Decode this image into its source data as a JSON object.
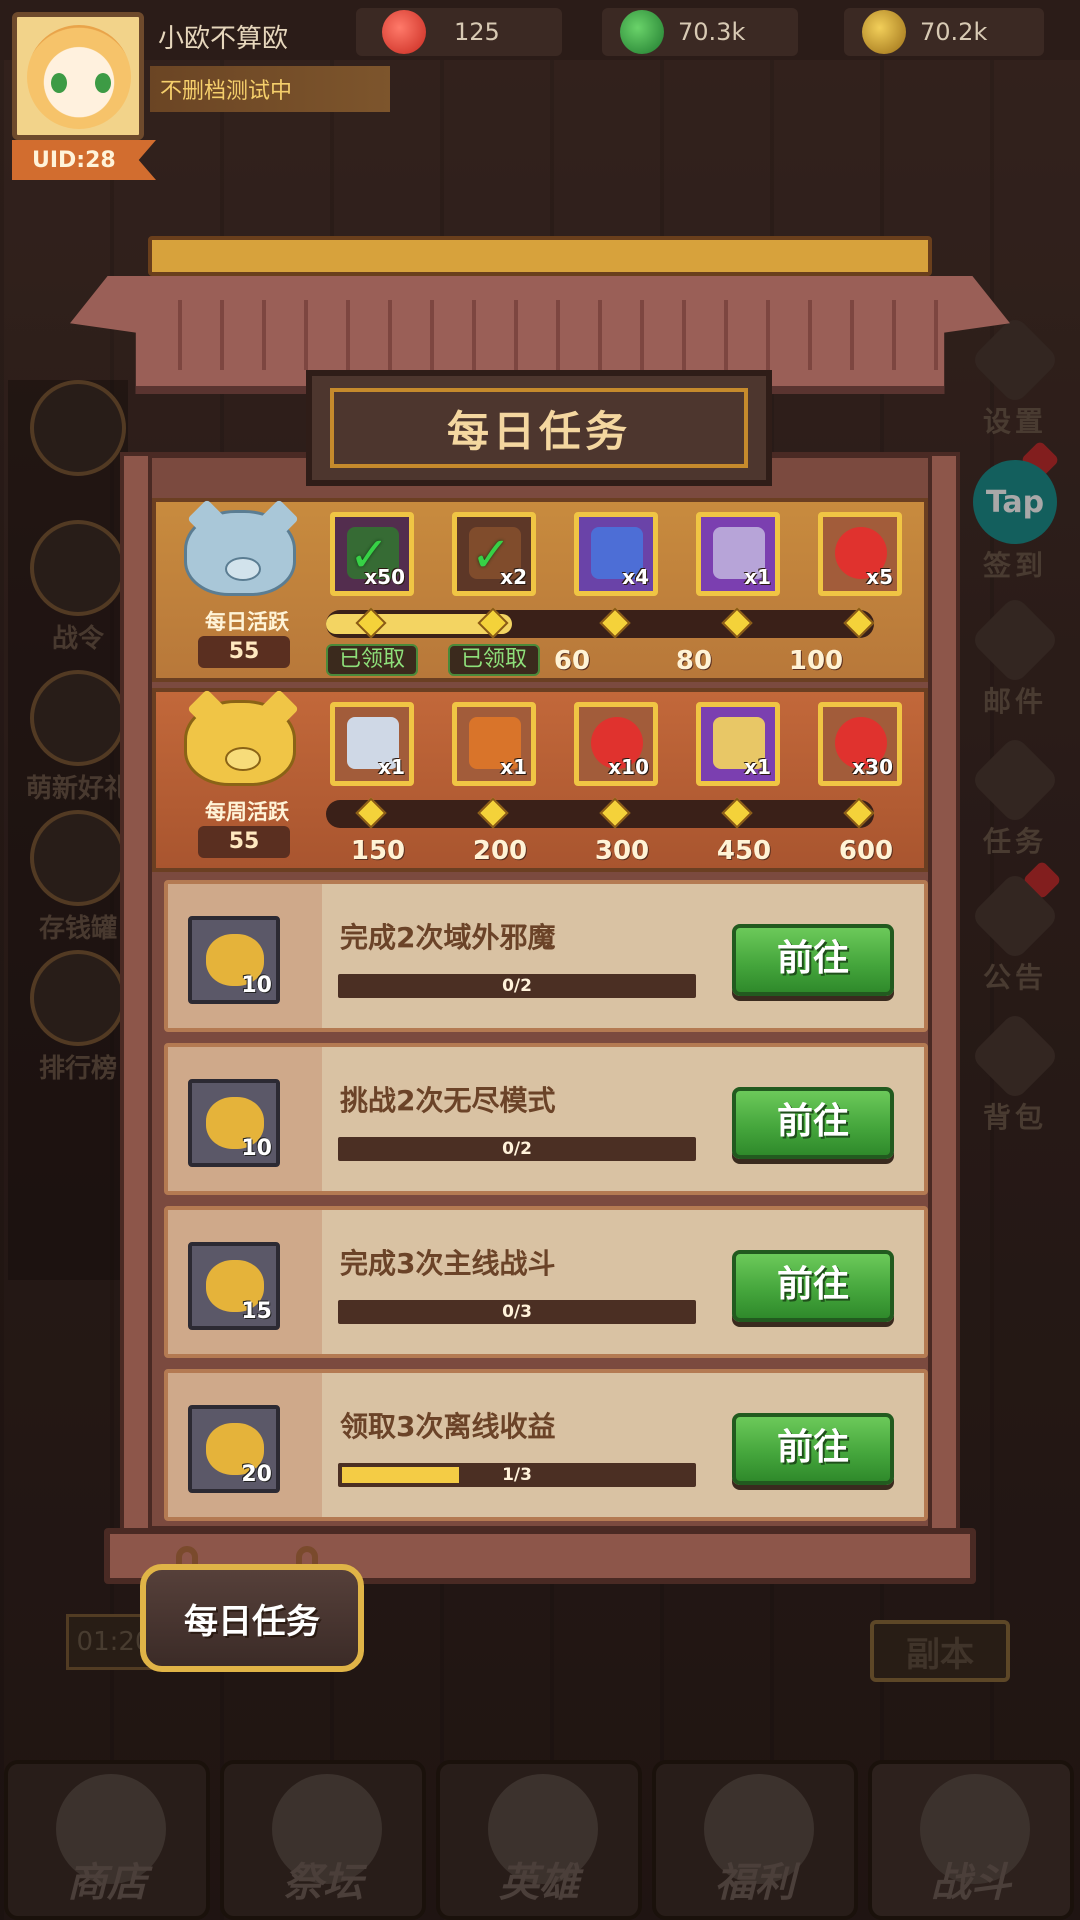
{
  "header": {
    "player_name": "小欧不算欧",
    "player_tag": "不删档测试中",
    "uid": "UID:28",
    "resources": [
      {
        "icon": "apple-icon",
        "value": "125",
        "color": "#d93a34"
      },
      {
        "icon": "green-gem-icon",
        "value": "70.3k",
        "color": "#2d8e3c"
      },
      {
        "icon": "gold-coin-icon",
        "value": "70.2k",
        "color": "#c9961f"
      }
    ]
  },
  "left_sidebar": [
    {
      "icon": "refresh-icon",
      "label": ""
    },
    {
      "icon": "battle-pass-icon",
      "label": "战令"
    },
    {
      "icon": "gift-box-icon",
      "label": "萌新好礼"
    },
    {
      "icon": "piggy-bank-icon",
      "label": "存钱罐"
    },
    {
      "icon": "ranking-banner-icon",
      "label": "排行榜"
    }
  ],
  "right_sidebar": {
    "settings": "设置",
    "checkin_badge": "Tap",
    "checkin": "签到",
    "mail": "邮件",
    "tasks": "任务",
    "notice": "公告",
    "bag": "背包"
  },
  "panel": {
    "title": "每日任务",
    "daily": {
      "label": "每日活跃",
      "value": "55",
      "rewards": [
        {
          "icon": "green-gem-icon",
          "count": "x50",
          "claimed": true
        },
        {
          "icon": "wrench-icon",
          "count": "x2",
          "claimed": true
        },
        {
          "icon": "blue-chest-icon",
          "count": "x4",
          "claimed": false
        },
        {
          "icon": "purple-chest-icon",
          "count": "x1",
          "claimed": false
        },
        {
          "icon": "apple-icon",
          "count": "x5",
          "claimed": false
        }
      ],
      "milestones": [
        "60",
        "80",
        "100"
      ],
      "claimed_label": "已领取",
      "progress_fraction": 0.34
    },
    "weekly": {
      "label": "每周活跃",
      "value": "55",
      "rewards": [
        {
          "icon": "magic-wand-icon",
          "count": "x1"
        },
        {
          "icon": "golden-key-icon",
          "count": "x1"
        },
        {
          "icon": "apple-icon",
          "count": "x10"
        },
        {
          "icon": "gold-chest-icon",
          "count": "x1"
        },
        {
          "icon": "apple-icon",
          "count": "x30"
        }
      ],
      "milestones": [
        "150",
        "200",
        "300",
        "450",
        "600"
      ],
      "progress_fraction": 0
    },
    "tasks": [
      {
        "title": "完成2次域外邪魔",
        "reward_count": "10",
        "progress": "0/2",
        "fraction": 0,
        "button": "前往"
      },
      {
        "title": "挑战2次无尽模式",
        "reward_count": "10",
        "progress": "0/2",
        "fraction": 0,
        "button": "前往"
      },
      {
        "title": "完成3次主线战斗",
        "reward_count": "15",
        "progress": "0/3",
        "fraction": 0,
        "button": "前往"
      },
      {
        "title": "领取3次离线收益",
        "reward_count": "20",
        "progress": "1/3",
        "fraction": 0.333,
        "button": "前往"
      }
    ]
  },
  "background": {
    "timer": "01:20",
    "dungeon_button": "副本"
  },
  "bottom_sign": "每日任务",
  "bottom_nav": [
    {
      "icon": "shop-icon",
      "label": "商店"
    },
    {
      "icon": "altar-icon",
      "label": "祭坛"
    },
    {
      "icon": "hero-icon",
      "label": "英雄"
    },
    {
      "icon": "welfare-bag-icon",
      "label": "福利"
    },
    {
      "icon": "battle-icon",
      "label": "战斗"
    }
  ]
}
